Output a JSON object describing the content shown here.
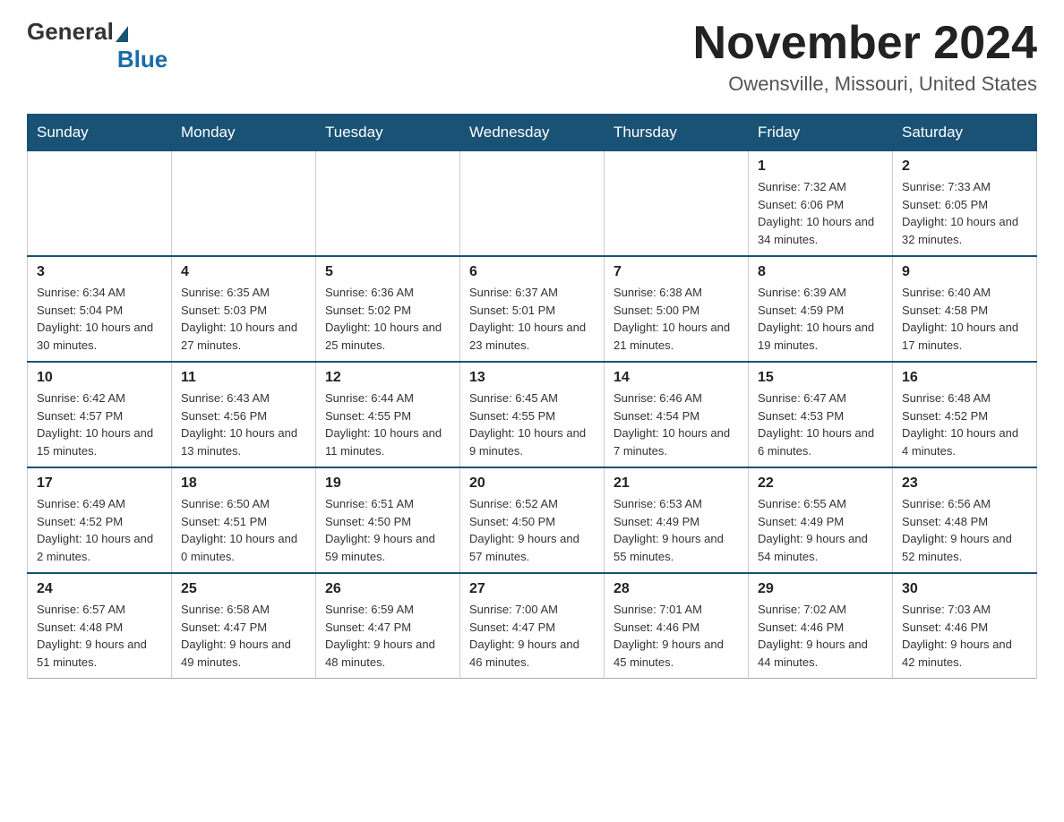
{
  "header": {
    "logo": {
      "part1": "General",
      "part2": "Blue"
    },
    "title": "November 2024",
    "location": "Owensville, Missouri, United States"
  },
  "calendar": {
    "days_of_week": [
      "Sunday",
      "Monday",
      "Tuesday",
      "Wednesday",
      "Thursday",
      "Friday",
      "Saturday"
    ],
    "weeks": [
      [
        {
          "day": "",
          "info": ""
        },
        {
          "day": "",
          "info": ""
        },
        {
          "day": "",
          "info": ""
        },
        {
          "day": "",
          "info": ""
        },
        {
          "day": "",
          "info": ""
        },
        {
          "day": "1",
          "info": "Sunrise: 7:32 AM\nSunset: 6:06 PM\nDaylight: 10 hours and 34 minutes."
        },
        {
          "day": "2",
          "info": "Sunrise: 7:33 AM\nSunset: 6:05 PM\nDaylight: 10 hours and 32 minutes."
        }
      ],
      [
        {
          "day": "3",
          "info": "Sunrise: 6:34 AM\nSunset: 5:04 PM\nDaylight: 10 hours and 30 minutes."
        },
        {
          "day": "4",
          "info": "Sunrise: 6:35 AM\nSunset: 5:03 PM\nDaylight: 10 hours and 27 minutes."
        },
        {
          "day": "5",
          "info": "Sunrise: 6:36 AM\nSunset: 5:02 PM\nDaylight: 10 hours and 25 minutes."
        },
        {
          "day": "6",
          "info": "Sunrise: 6:37 AM\nSunset: 5:01 PM\nDaylight: 10 hours and 23 minutes."
        },
        {
          "day": "7",
          "info": "Sunrise: 6:38 AM\nSunset: 5:00 PM\nDaylight: 10 hours and 21 minutes."
        },
        {
          "day": "8",
          "info": "Sunrise: 6:39 AM\nSunset: 4:59 PM\nDaylight: 10 hours and 19 minutes."
        },
        {
          "day": "9",
          "info": "Sunrise: 6:40 AM\nSunset: 4:58 PM\nDaylight: 10 hours and 17 minutes."
        }
      ],
      [
        {
          "day": "10",
          "info": "Sunrise: 6:42 AM\nSunset: 4:57 PM\nDaylight: 10 hours and 15 minutes."
        },
        {
          "day": "11",
          "info": "Sunrise: 6:43 AM\nSunset: 4:56 PM\nDaylight: 10 hours and 13 minutes."
        },
        {
          "day": "12",
          "info": "Sunrise: 6:44 AM\nSunset: 4:55 PM\nDaylight: 10 hours and 11 minutes."
        },
        {
          "day": "13",
          "info": "Sunrise: 6:45 AM\nSunset: 4:55 PM\nDaylight: 10 hours and 9 minutes."
        },
        {
          "day": "14",
          "info": "Sunrise: 6:46 AM\nSunset: 4:54 PM\nDaylight: 10 hours and 7 minutes."
        },
        {
          "day": "15",
          "info": "Sunrise: 6:47 AM\nSunset: 4:53 PM\nDaylight: 10 hours and 6 minutes."
        },
        {
          "day": "16",
          "info": "Sunrise: 6:48 AM\nSunset: 4:52 PM\nDaylight: 10 hours and 4 minutes."
        }
      ],
      [
        {
          "day": "17",
          "info": "Sunrise: 6:49 AM\nSunset: 4:52 PM\nDaylight: 10 hours and 2 minutes."
        },
        {
          "day": "18",
          "info": "Sunrise: 6:50 AM\nSunset: 4:51 PM\nDaylight: 10 hours and 0 minutes."
        },
        {
          "day": "19",
          "info": "Sunrise: 6:51 AM\nSunset: 4:50 PM\nDaylight: 9 hours and 59 minutes."
        },
        {
          "day": "20",
          "info": "Sunrise: 6:52 AM\nSunset: 4:50 PM\nDaylight: 9 hours and 57 minutes."
        },
        {
          "day": "21",
          "info": "Sunrise: 6:53 AM\nSunset: 4:49 PM\nDaylight: 9 hours and 55 minutes."
        },
        {
          "day": "22",
          "info": "Sunrise: 6:55 AM\nSunset: 4:49 PM\nDaylight: 9 hours and 54 minutes."
        },
        {
          "day": "23",
          "info": "Sunrise: 6:56 AM\nSunset: 4:48 PM\nDaylight: 9 hours and 52 minutes."
        }
      ],
      [
        {
          "day": "24",
          "info": "Sunrise: 6:57 AM\nSunset: 4:48 PM\nDaylight: 9 hours and 51 minutes."
        },
        {
          "day": "25",
          "info": "Sunrise: 6:58 AM\nSunset: 4:47 PM\nDaylight: 9 hours and 49 minutes."
        },
        {
          "day": "26",
          "info": "Sunrise: 6:59 AM\nSunset: 4:47 PM\nDaylight: 9 hours and 48 minutes."
        },
        {
          "day": "27",
          "info": "Sunrise: 7:00 AM\nSunset: 4:47 PM\nDaylight: 9 hours and 46 minutes."
        },
        {
          "day": "28",
          "info": "Sunrise: 7:01 AM\nSunset: 4:46 PM\nDaylight: 9 hours and 45 minutes."
        },
        {
          "day": "29",
          "info": "Sunrise: 7:02 AM\nSunset: 4:46 PM\nDaylight: 9 hours and 44 minutes."
        },
        {
          "day": "30",
          "info": "Sunrise: 7:03 AM\nSunset: 4:46 PM\nDaylight: 9 hours and 42 minutes."
        }
      ]
    ]
  }
}
